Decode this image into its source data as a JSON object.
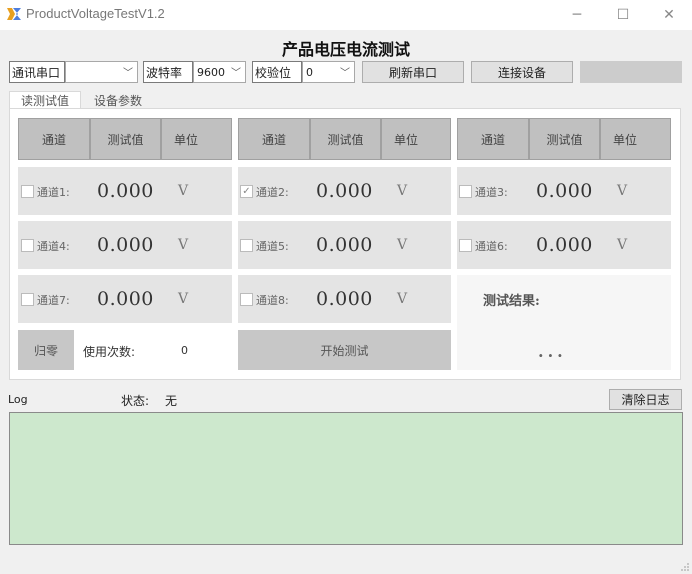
{
  "window": {
    "title": "ProductVoltageTestV1.2",
    "minimize_glyph": "─",
    "maximize_glyph": "☐",
    "close_glyph": "✕"
  },
  "header": {
    "title": "产品电压电流测试"
  },
  "toolbar": {
    "port_label": "通讯串口",
    "port_value": "",
    "baud_label": "波特率",
    "baud_value": "9600",
    "parity_label": "校验位",
    "parity_value": "0",
    "refresh_label": "刷新串口",
    "connect_label": "连接设备",
    "status_box": ""
  },
  "tabs": [
    {
      "label": "读测试值",
      "active": true
    },
    {
      "label": "设备参数",
      "active": false
    }
  ],
  "grid": {
    "headers": [
      "通道",
      "测试值",
      "单位"
    ],
    "channels": [
      {
        "label": "通道1:",
        "value": "0.000",
        "unit": "V",
        "checked": false
      },
      {
        "label": "通道2:",
        "value": "0.000",
        "unit": "V",
        "checked": true
      },
      {
        "label": "通道3:",
        "value": "0.000",
        "unit": "V",
        "checked": false
      },
      {
        "label": "通道4:",
        "value": "0.000",
        "unit": "V",
        "checked": false
      },
      {
        "label": "通道5:",
        "value": "0.000",
        "unit": "V",
        "checked": false
      },
      {
        "label": "通道6:",
        "value": "0.000",
        "unit": "V",
        "checked": false
      },
      {
        "label": "通道7:",
        "value": "0.000",
        "unit": "V",
        "checked": false
      },
      {
        "label": "通道8:",
        "value": "0.000",
        "unit": "V",
        "checked": false
      }
    ],
    "result_label": "测试结果:",
    "result_value": "...",
    "zero_label": "归零",
    "usage_label": "使用次数:",
    "usage_count": "0",
    "start_label": "开始测试"
  },
  "log": {
    "label": "Log",
    "status_label": "状态:",
    "status_value": "无",
    "clear_label": "清除日志",
    "content": ""
  },
  "colors": {
    "header_bg": "#c0c0c0",
    "cell_bg": "#e4e4e4",
    "log_bg": "#cde8cd"
  }
}
